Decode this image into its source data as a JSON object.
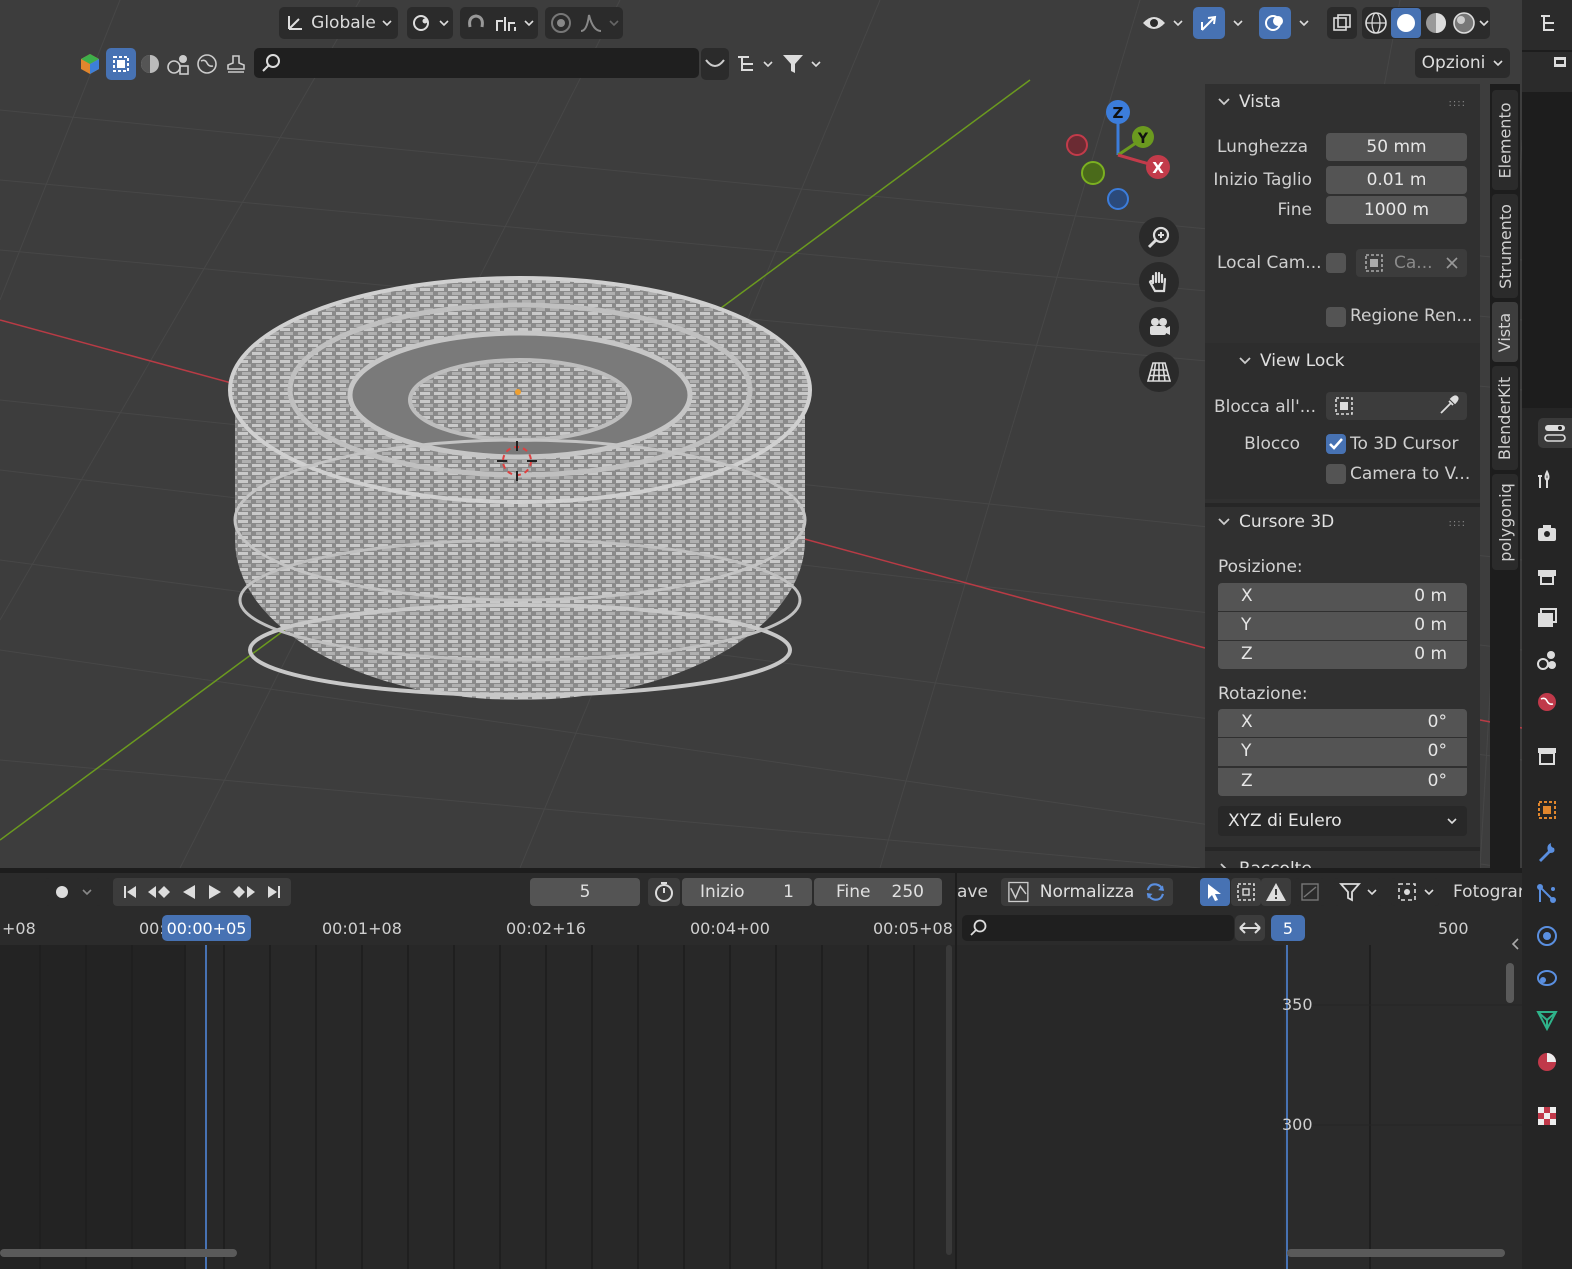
{
  "header": {
    "transform_orientation": "Globale",
    "options_label": "Opzioni"
  },
  "colors": {
    "accent": "#4772b3",
    "viewport_bg": "#3d3d3d",
    "axis_x": "#c23b4a",
    "axis_y": "#6b9a1f",
    "axis_z": "#3c7ddb"
  },
  "gizmo": {
    "z": "Z",
    "y": "Y",
    "x": "X"
  },
  "icons": {
    "nav": [
      "zoom-icon",
      "hand-pan-icon",
      "camera-icon",
      "grid-perspective-icon"
    ]
  },
  "npanel": {
    "vista": {
      "title": "Vista",
      "lunghezza_label": "Lunghezza",
      "lunghezza_value": "50 mm",
      "inizio_taglio_label": "Inizio Taglio",
      "inizio_taglio_value": "0.01 m",
      "fine_label": "Fine",
      "fine_value": "1000 m",
      "local_camera_label": "Local Cam...",
      "local_camera_value": "Ca...",
      "regione_label": "Regione Ren..."
    },
    "view_lock": {
      "title": "View Lock",
      "blocca_label": "Blocca all'...",
      "blocco_label": "Blocco",
      "to_3d_cursor": "To 3D Cursor",
      "camera_to_view": "Camera to V..."
    },
    "cursore": {
      "title": "Cursore 3D",
      "posizione_label": "Posizione:",
      "pos": [
        {
          "axis": "X",
          "value": "0 m"
        },
        {
          "axis": "Y",
          "value": "0 m"
        },
        {
          "axis": "Z",
          "value": "0 m"
        }
      ],
      "rotazione_label": "Rotazione:",
      "rot": [
        {
          "axis": "X",
          "value": "0°"
        },
        {
          "axis": "Y",
          "value": "0°"
        },
        {
          "axis": "Z",
          "value": "0°"
        }
      ],
      "rotation_mode": "XYZ di Eulero"
    },
    "raccolte": {
      "title": "Raccolte"
    }
  },
  "vtabs": [
    "Elemento",
    "Strumento",
    "Vista",
    "BlenderKit",
    "polygoniq"
  ],
  "timeline": {
    "current_frame": "5",
    "inizio_label": "Inizio",
    "inizio_value": "1",
    "fine_label": "Fine",
    "fine_value": "250",
    "ruler": [
      "+08",
      "00:",
      "00:00+05",
      "00:01+08",
      "00:02+16",
      "00:04+00",
      "00:05+08"
    ]
  },
  "graph": {
    "ave_label": "ave",
    "normalize_label": "Normalizza",
    "fotogram_label": "Fotogran",
    "frame_badge": "5",
    "ruler_500": "500",
    "y_labels": [
      "350",
      "300"
    ]
  }
}
